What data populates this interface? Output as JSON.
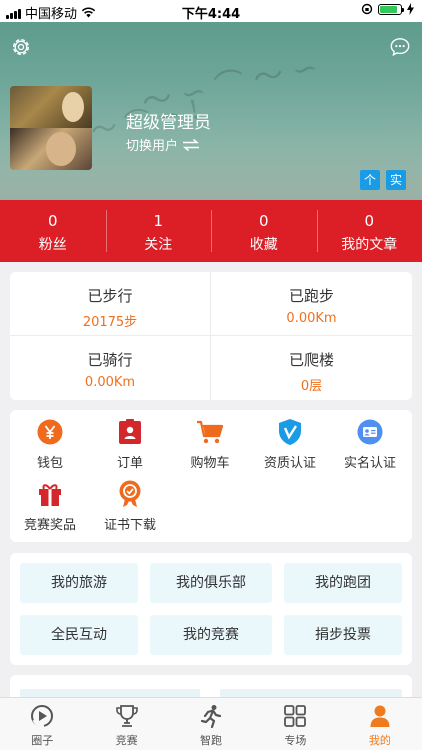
{
  "status_bar": {
    "carrier": "中国移动",
    "time": "下午4:44"
  },
  "profile": {
    "username": "超级管理员",
    "switch_label": "切换用户",
    "tags": [
      "个",
      "实"
    ]
  },
  "stats": [
    {
      "value": "0",
      "label": "粉丝"
    },
    {
      "value": "1",
      "label": "关注"
    },
    {
      "value": "0",
      "label": "收藏"
    },
    {
      "value": "0",
      "label": "我的文章"
    }
  ],
  "activity": [
    {
      "title": "已步行",
      "value": "20175步"
    },
    {
      "title": "已跑步",
      "value": "0.00Km"
    },
    {
      "title": "已骑行",
      "value": "0.00Km"
    },
    {
      "title": "已爬楼",
      "value": "0层"
    }
  ],
  "services": [
    {
      "label": "钱包",
      "icon": "yen-icon"
    },
    {
      "label": "订单",
      "icon": "order-icon"
    },
    {
      "label": "购物车",
      "icon": "cart-icon"
    },
    {
      "label": "资质认证",
      "icon": "shield-icon"
    },
    {
      "label": "实名认证",
      "icon": "id-card-icon"
    },
    {
      "label": "竞赛奖品",
      "icon": "gift-icon"
    },
    {
      "label": "证书下载",
      "icon": "certificate-icon"
    }
  ],
  "quick_links": [
    "我的旅游",
    "我的俱乐部",
    "我的跑团",
    "全民互动",
    "我的竞赛",
    "捐步投票"
  ],
  "tabs": [
    {
      "label": "圈子",
      "icon": "circle-icon"
    },
    {
      "label": "竞赛",
      "icon": "trophy-icon"
    },
    {
      "label": "智跑",
      "icon": "runner-icon"
    },
    {
      "label": "专场",
      "icon": "grid-icon"
    },
    {
      "label": "我的",
      "icon": "person-icon",
      "active": true
    }
  ],
  "colors": {
    "brand_red": "#dc1f26",
    "accent_orange": "#f07a1e",
    "tag_blue": "#1a9be6",
    "quick_bg": "#eaf7fb"
  }
}
